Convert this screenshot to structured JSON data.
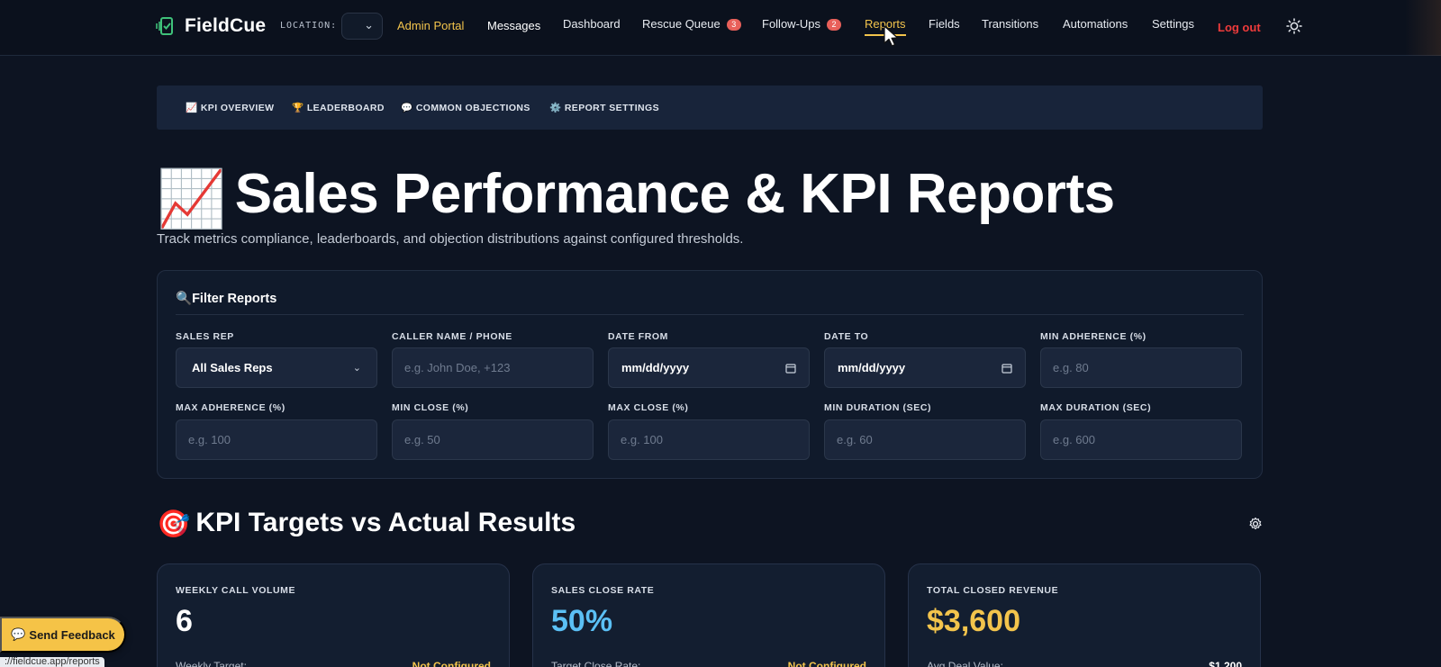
{
  "app": {
    "name": "FieldCue",
    "location_label": "LOCATION:",
    "location_value": ""
  },
  "nav": {
    "admin_portal": "Admin Portal",
    "messages": "Messages",
    "dashboard": "Dashboard",
    "rescue_queue": "Rescue Queue",
    "rescue_queue_count": "3",
    "follow_ups": "Follow-Ups",
    "follow_ups_count": "2",
    "reports": "Reports",
    "fields": "Fields",
    "transitions": "Transitions",
    "automations": "Automations",
    "settings": "Settings",
    "logout": "Log out",
    "active": "Reports"
  },
  "subtabs": [
    {
      "icon": "📈",
      "label": "KPI OVERVIEW"
    },
    {
      "icon": "🏆",
      "label": "LEADERBOARD"
    },
    {
      "icon": "💬",
      "label": "COMMON OBJECTIONS"
    },
    {
      "icon": "⚙️",
      "label": "REPORT SETTINGS"
    }
  ],
  "page": {
    "title_icon": "📈",
    "title": "Sales Performance & KPI Reports",
    "subtitle": "Track metrics compliance, leaderboards, and objection distributions against configured thresholds."
  },
  "filters": {
    "title_icon": "🔍",
    "title": "Filter Reports",
    "sales_rep": {
      "label": "SALES REP",
      "value": "All Sales Reps"
    },
    "caller": {
      "label": "CALLER NAME / PHONE",
      "placeholder": "e.g. John Doe, +123"
    },
    "date_from": {
      "label": "DATE FROM",
      "value": "mm/dd/yyyy"
    },
    "date_to": {
      "label": "DATE TO",
      "value": "mm/dd/yyyy"
    },
    "min_adherence": {
      "label": "MIN ADHERENCE (%)",
      "placeholder": "e.g. 80"
    },
    "max_adherence": {
      "label": "MAX ADHERENCE (%)",
      "placeholder": "e.g. 100"
    },
    "min_close": {
      "label": "MIN CLOSE (%)",
      "placeholder": "e.g. 50"
    },
    "max_close": {
      "label": "MAX CLOSE (%)",
      "placeholder": "e.g. 100"
    },
    "min_duration": {
      "label": "MIN DURATION (SEC)",
      "placeholder": "e.g. 60"
    },
    "max_duration": {
      "label": "MAX DURATION (SEC)",
      "placeholder": "e.g. 600"
    }
  },
  "kpi": {
    "title_icon": "🎯",
    "title": "KPI Targets vs Actual Results",
    "cards": [
      {
        "label": "WEEKLY CALL VOLUME",
        "value": "6",
        "value_color": "#ffffff",
        "foot_label": "Weekly Target:",
        "foot_value": "Not Configured",
        "foot_color": "#f3c44c"
      },
      {
        "label": "SALES CLOSE RATE",
        "value": "50%",
        "value_color": "#5bc0f5",
        "foot_label": "Target Close Rate:",
        "foot_value": "Not Configured",
        "foot_color": "#f3c44c"
      },
      {
        "label": "TOTAL CLOSED REVENUE",
        "value": "$3,600",
        "value_color": "#f3c44c",
        "foot_label": "Avg Deal Value:",
        "foot_value": "$1,200",
        "foot_color": "#ffffff"
      }
    ]
  },
  "feedback": {
    "icon": "💬",
    "label": "Send Feedback"
  },
  "status_bar": {
    "url": "://fieldcue.app/reports"
  },
  "colors": {
    "accent": "#f3c44c",
    "danger": "#ef3b3b",
    "badge": "#e8605a",
    "bg": "#0d1422"
  }
}
